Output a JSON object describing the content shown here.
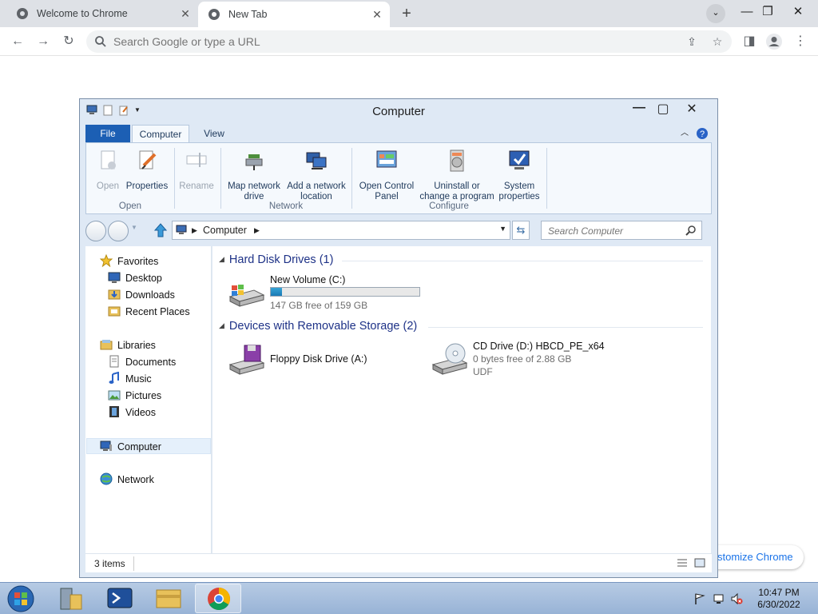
{
  "browser": {
    "tabs": [
      {
        "title": "Welcome to Chrome",
        "active": false
      },
      {
        "title": "New Tab",
        "active": true
      }
    ],
    "omnibox_placeholder": "Search Google or type a URL",
    "customize_label": "stomize Chrome"
  },
  "explorer": {
    "title": "Computer",
    "ribbon_tabs": {
      "file": "File",
      "computer": "Computer",
      "view": "View"
    },
    "ribbon": {
      "open": "Open",
      "properties": "Properties",
      "rename": "Rename",
      "map_network_1": "Map network",
      "map_network_2": "drive",
      "add_network_1": "Add a network",
      "add_network_2": "location",
      "control_panel_1": "Open Control",
      "control_panel_2": "Panel",
      "uninstall_1": "Uninstall or",
      "uninstall_2": "change a program",
      "system_1": "System",
      "system_2": "properties",
      "group_open": "Open",
      "group_network": "Network",
      "group_configure": "Configure"
    },
    "address": {
      "crumb": "Computer"
    },
    "search_placeholder": "Search Computer",
    "nav": {
      "favorites": "Favorites",
      "desktop": "Desktop",
      "downloads": "Downloads",
      "recent": "Recent Places",
      "libraries": "Libraries",
      "documents": "Documents",
      "music": "Music",
      "pictures": "Pictures",
      "videos": "Videos",
      "computer": "Computer",
      "network": "Network"
    },
    "groups": {
      "hdd": "Hard Disk Drives (1)",
      "removable": "Devices with Removable Storage (2)"
    },
    "drives": {
      "c": {
        "name": "New Volume (C:)",
        "free": "147 GB free of 159 GB",
        "used_fraction": 0.075
      },
      "a": {
        "name": "Floppy Disk Drive (A:)"
      },
      "d": {
        "name": "CD Drive (D:) HBCD_PE_x64",
        "free": "0 bytes free of 2.88 GB",
        "fs": "UDF"
      }
    },
    "status": "3 items"
  },
  "taskbar": {
    "time": "10:47 PM",
    "date": "6/30/2022"
  }
}
